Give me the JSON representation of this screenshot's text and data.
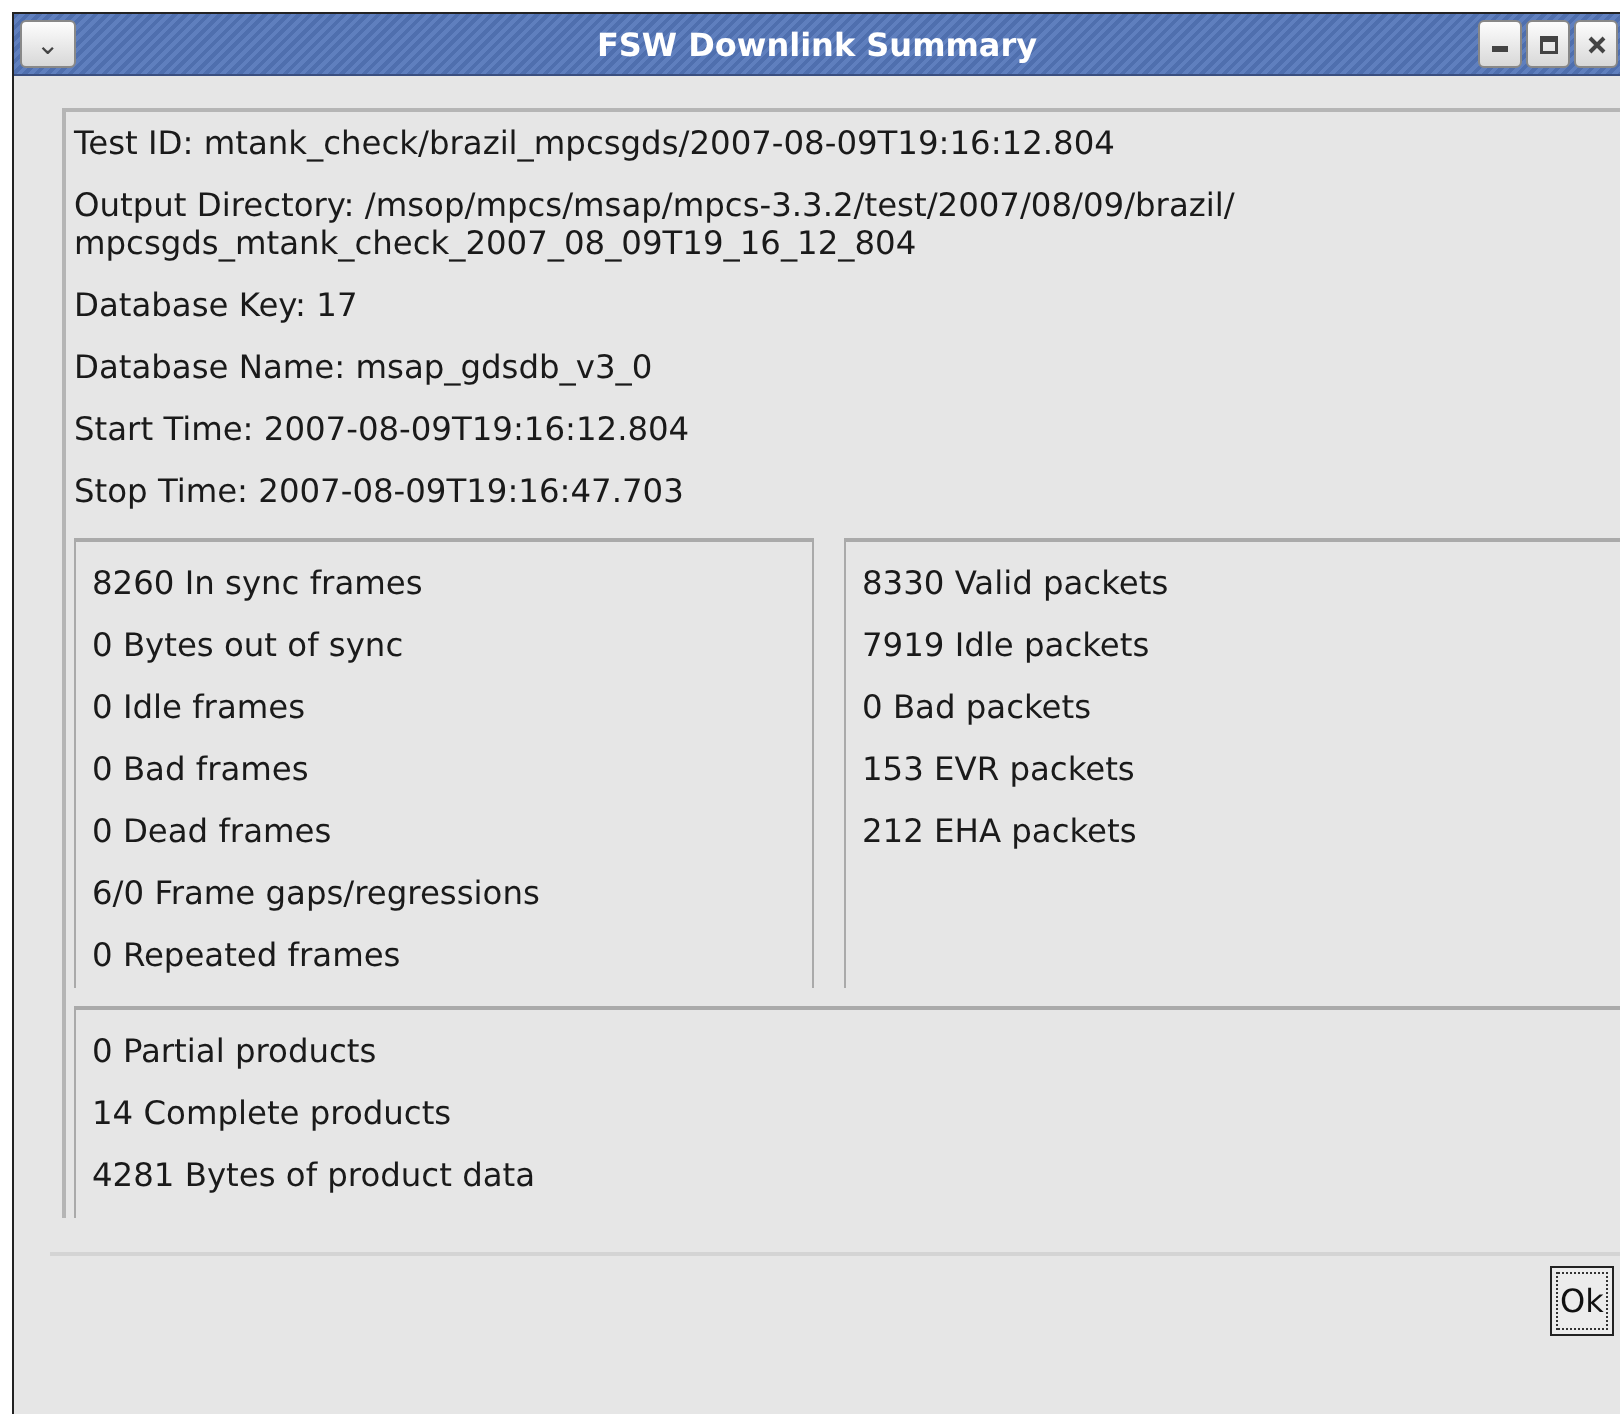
{
  "window": {
    "title": "FSW Downlink Summary",
    "menu_glyph": "⌄"
  },
  "info": [
    "Test ID: mtank_check/brazil_mpcsgds/2007-08-09T19:16:12.804",
    "Output Directory: /msop/mpcs/msap/mpcs-3.3.2/test/2007/08/09/brazil/\nmpcsgds_mtank_check_2007_08_09T19_16_12_804",
    "Database Key: 17",
    "Database Name: msap_gdsdb_v3_0",
    "Start Time: 2007-08-09T19:16:12.804",
    "Stop Time: 2007-08-09T19:16:47.703"
  ],
  "frames": [
    "8260 In sync frames",
    "0 Bytes out of sync",
    "0 Idle frames",
    "0 Bad frames",
    "0 Dead frames",
    "6/0 Frame gaps/regressions",
    "0 Repeated frames"
  ],
  "packets": [
    "8330 Valid packets",
    "7919 Idle packets",
    "0 Bad packets",
    "153 EVR packets",
    "212 EHA packets"
  ],
  "products": [
    "0 Partial products",
    "14 Complete products",
    "4281 Bytes of product data"
  ],
  "buttons": [
    "Ok"
  ]
}
